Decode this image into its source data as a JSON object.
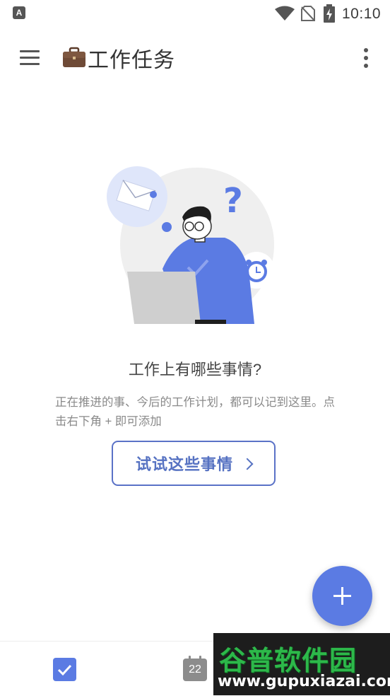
{
  "status_bar": {
    "time": "10:10",
    "icons": [
      "app-notification-icon",
      "wifi-icon",
      "no-sim-icon",
      "battery-charging-icon"
    ]
  },
  "app_bar": {
    "title": "工作任务",
    "icons": [
      "menu-icon",
      "briefcase-icon",
      "more-vert-icon"
    ]
  },
  "empty_state": {
    "title": "工作上有哪些事情?",
    "description": "正在推进的事、今后的工作计划，都可以记到这里。点击右下角 + 即可添加",
    "button_label": "试试这些事情",
    "illustration": "person-at-laptop-illustration"
  },
  "fab": {
    "icon": "add-icon"
  },
  "bottom_nav": {
    "tabs": [
      {
        "icon": "checkbox-icon",
        "active": true
      },
      {
        "icon": "calendar-icon",
        "day": "22",
        "active": false
      }
    ]
  },
  "watermark": {
    "logo_text": "谷普软件园",
    "url": "www.gupuxiazai.com"
  },
  "colors": {
    "accent": "#5b7be3",
    "button_text": "#5672c2",
    "muted_text": "#8a8a8a"
  }
}
